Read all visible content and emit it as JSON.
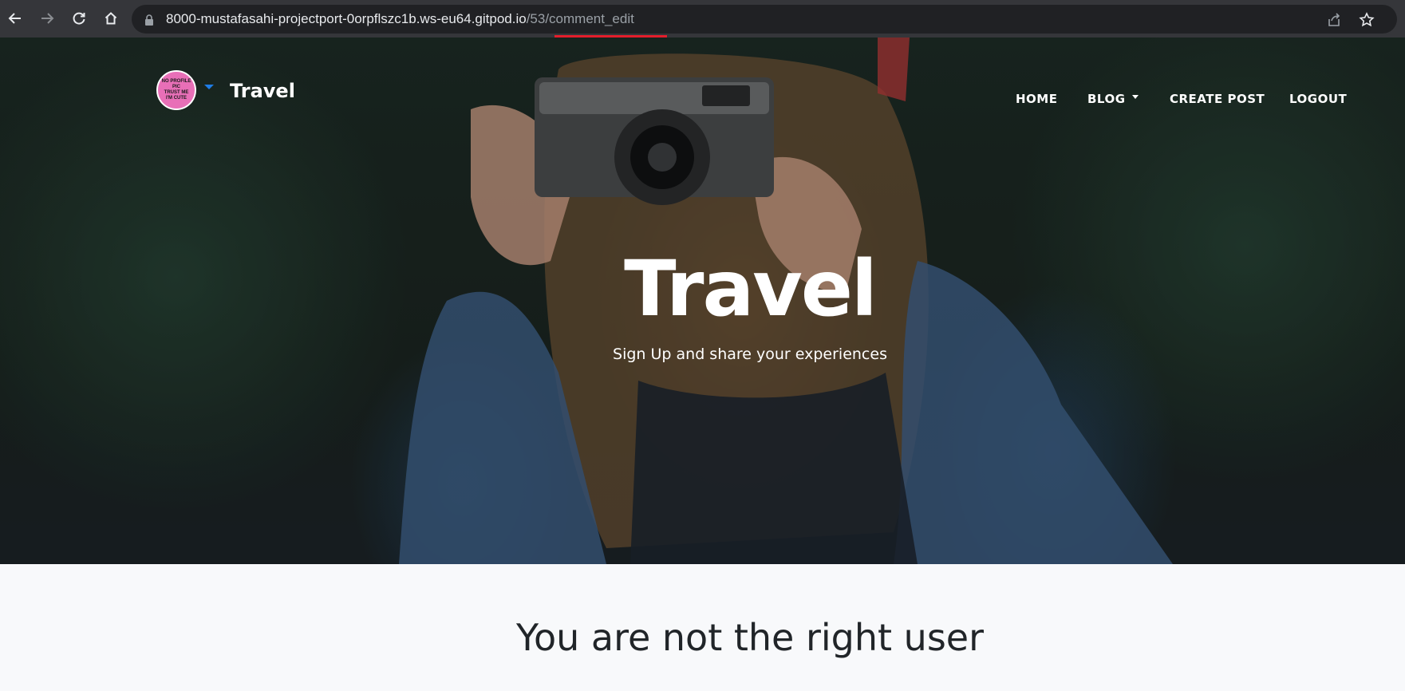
{
  "browser": {
    "url_host": "8000-mustafasahi-projectport-0orpflszc1b.ws-eu64.gitpod.io",
    "url_path": "/53/comment_edit",
    "icons": [
      "back-icon",
      "forward-icon",
      "reload-icon",
      "home-icon",
      "lock-icon",
      "share-icon",
      "star-icon"
    ]
  },
  "navbar": {
    "brand": "Travel",
    "avatar_text": [
      "NO PROFILE",
      "PIC",
      "TRUST ME",
      "I'M CUTE"
    ],
    "links": {
      "home": "HOME",
      "blog": "BLOG",
      "create_post": "CREATE POST",
      "logout": "LOGOUT"
    }
  },
  "hero": {
    "title": "Travel",
    "subtitle": "Sign Up and share your experiences"
  },
  "main": {
    "message": "You are not the right user"
  },
  "colors": {
    "avatar_bg": "#e86fb7",
    "caret": "#1f7de6",
    "loading_bar": "#e41e2b",
    "page_bg": "#f8f9fb",
    "text_dark": "#212529"
  }
}
